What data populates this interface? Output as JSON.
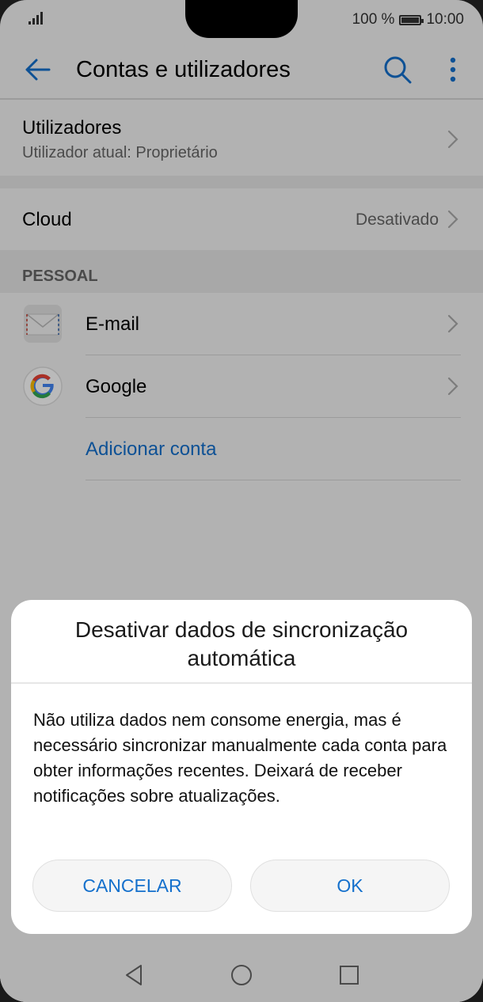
{
  "status_bar": {
    "battery_percent": "100 %",
    "time": "10:00"
  },
  "app_bar": {
    "title": "Contas e utilizadores"
  },
  "users": {
    "title": "Utilizadores",
    "subtitle": "Utilizador atual: Proprietário"
  },
  "cloud": {
    "title": "Cloud",
    "value": "Desativado"
  },
  "personal": {
    "section_title": "PESSOAL",
    "accounts": [
      {
        "label": "E-mail",
        "icon": "mail-icon"
      },
      {
        "label": "Google",
        "icon": "google-icon"
      }
    ],
    "add_account": "Adicionar conta"
  },
  "dialog": {
    "title": "Desativar dados de sincronização automática",
    "body": "Não utiliza dados nem consome energia, mas é necessário sincronizar manualmente cada conta para obter informações recentes. Deixará de receber notificações sobre atualizações.",
    "cancel_label": "CANCELAR",
    "ok_label": "OK"
  },
  "colors": {
    "accent": "#1470cc",
    "background": "#f5f5f5",
    "section_gap": "#e6e6e6"
  }
}
